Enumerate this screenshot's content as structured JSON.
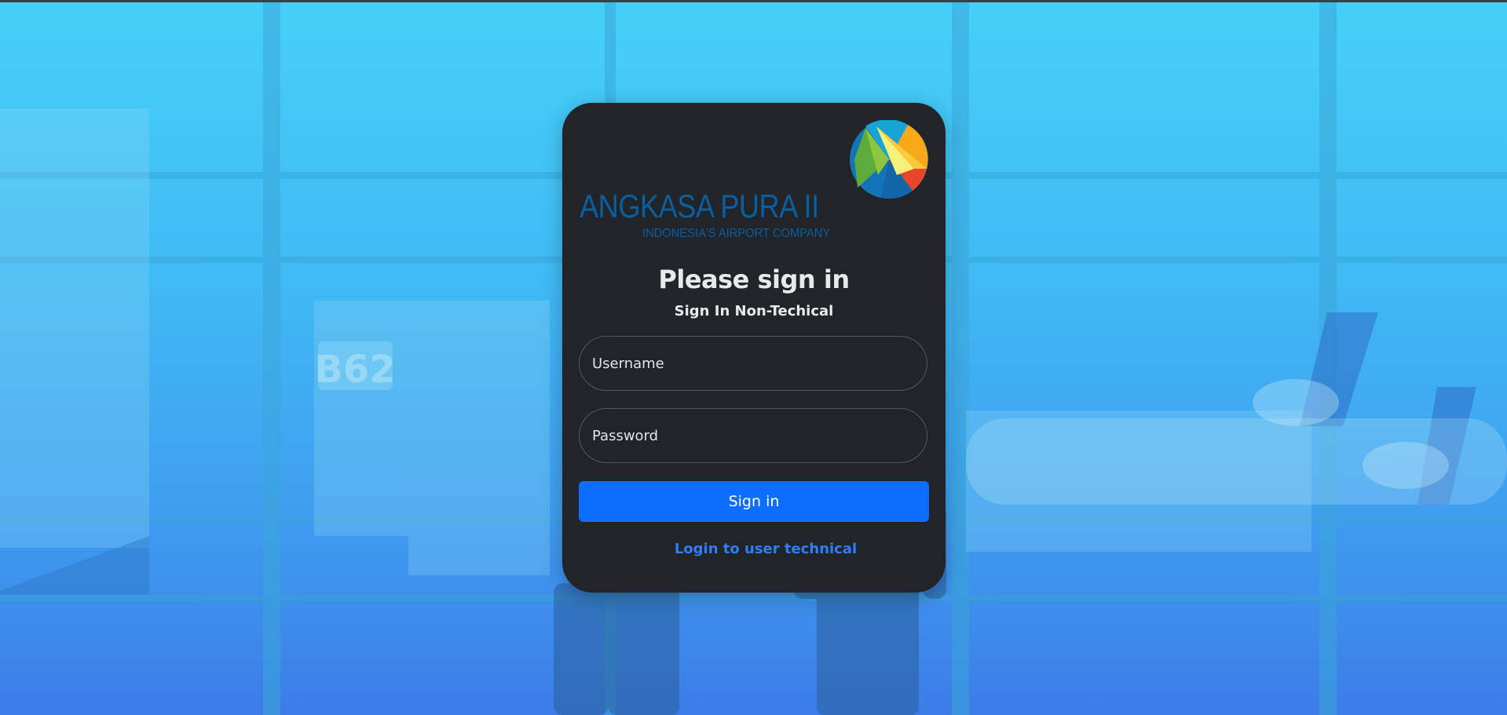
{
  "brand": {
    "name": "ANGKASA PURA II",
    "tagline": "INDONESIA'S AIRPORT COMPANY"
  },
  "login": {
    "title": "Please sign in",
    "subtitle": "Sign In Non-Techical",
    "username_placeholder": "Username",
    "username_value": "",
    "password_placeholder": "Password",
    "password_value": "",
    "submit_label": "Sign in",
    "alt_login_link": "Login to user technical"
  },
  "background": {
    "gate_sign": "B62"
  },
  "colors": {
    "card_bg": "#212429",
    "primary_button": "#0d6efd",
    "link": "#2f7ef7",
    "brand_blue": "#0b5e9f",
    "background_top": "#45d0f8",
    "background_bottom": "#3c7ce8"
  },
  "icons": {
    "logo": "angkasa-pura-logo-icon"
  }
}
